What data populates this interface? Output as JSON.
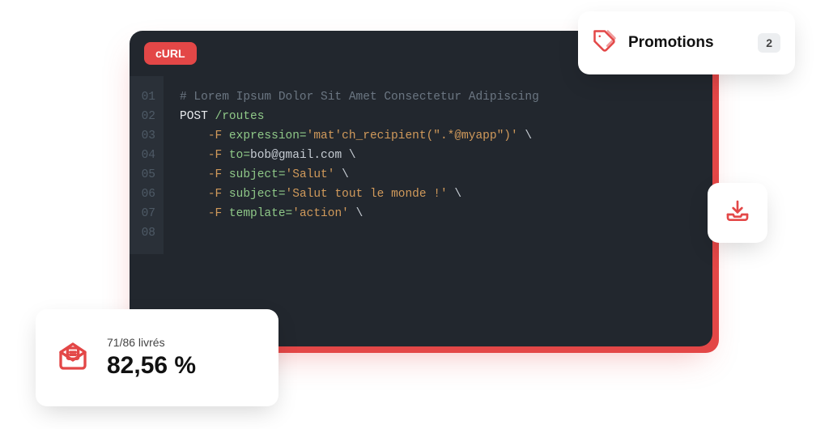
{
  "editor": {
    "language_tab": "cURL",
    "line_numbers": [
      "01",
      "02",
      "03",
      "04",
      "05",
      "06",
      "07",
      "08"
    ],
    "lines": {
      "l1_comment": "# Lorem Ipsum Dolor Sit Amet Consectetur Adipiscing",
      "l2_method": "POST",
      "l2_path": "/routes",
      "l3_flag": "-F",
      "l3_param": "expression=",
      "l3_value": "'mat'ch_recipient(\".*@myapp\")'",
      "l3_trail": " \\",
      "l4_flag": "-F",
      "l4_param": "to=",
      "l4_value": "bob@gmail.com",
      "l4_trail": " \\",
      "l5_flag": "-F",
      "l5_param": "subject=",
      "l5_value": "'Salut'",
      "l5_trail": " \\",
      "l6_flag": "-F",
      "l6_param": "subject=",
      "l6_value": "'Salut tout le monde !'",
      "l6_trail": " \\",
      "l7_flag": "-F",
      "l7_param": "template=",
      "l7_value": "'action'",
      "l7_trail": " \\"
    }
  },
  "promotions": {
    "label": "Promotions",
    "count": "2"
  },
  "stats": {
    "subtitle": "71/86 livrés",
    "percentage": "82,56 %"
  },
  "colors": {
    "accent": "#e34747",
    "editor_bg": "#22272e"
  }
}
